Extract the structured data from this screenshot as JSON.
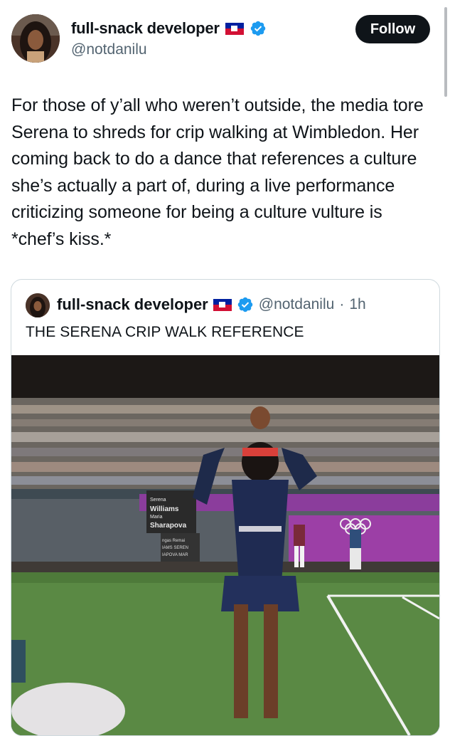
{
  "author": {
    "name": "full-snack developer",
    "handle": "@notdanilu",
    "follow_label": "Follow"
  },
  "tweet_text": "For those of y’all who weren’t outside, the media tore Serena to shreds for crip walking at Wimbledon. Her coming back to do a dance that references a culture she’s actually a part of, during a live performance criticizing someone for being a culture vulture is *chef’s kiss.*",
  "quoted": {
    "name": "full-snack developer",
    "handle": "@notdanilu",
    "separator": "·",
    "time": "1h",
    "text": "THE SERENA CRIP WALK REFERENCE",
    "media": {
      "scoreboard_lines": [
        "Serena",
        "Williams",
        "Maria",
        "Sharapova"
      ],
      "small_board_lines": [
        "ngas Remai",
        "IAMS SEREN",
        "IAPOVA MAR"
      ]
    }
  },
  "colors": {
    "verified": "#1d9bf0",
    "follow_bg": "#0f1419",
    "grass": "#4e7a3a",
    "wall_purple": "#8b3d9c",
    "flag_blue": "#00209f",
    "flag_red": "#d21034"
  }
}
